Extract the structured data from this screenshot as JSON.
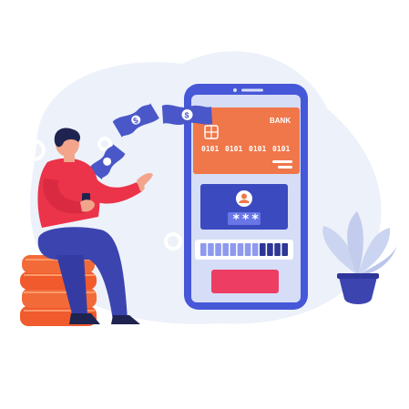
{
  "card": {
    "bank_label": "BANK",
    "numbers": [
      "0101",
      "0101",
      "0101",
      "0101"
    ]
  },
  "login": {
    "pin_mask": "***"
  },
  "money": {
    "symbol": "$"
  },
  "progress": {
    "filled_segments": 8,
    "total_segments": 12
  },
  "icons": [
    "chip-icon",
    "user-avatar-icon",
    "dollar-bill-icon",
    "coin-stack-icon",
    "plant-icon",
    "smartphone-icon"
  ],
  "colors": {
    "phone_body": "#4657D8",
    "phone_screen": "#D6DEF7",
    "card": "#F0774A",
    "login_panel": "#3C4ABF",
    "pin_box": "#6876E6",
    "confirm_button": "#EE3D63",
    "shirt": "#EB3349",
    "pants": "#3C44B0",
    "coins": "#F05A2C",
    "bill": "#4A57C8",
    "background_blob": "#EDF1FA",
    "plant_leaves": "#CBD4F0",
    "pot": "#3C44B0"
  }
}
